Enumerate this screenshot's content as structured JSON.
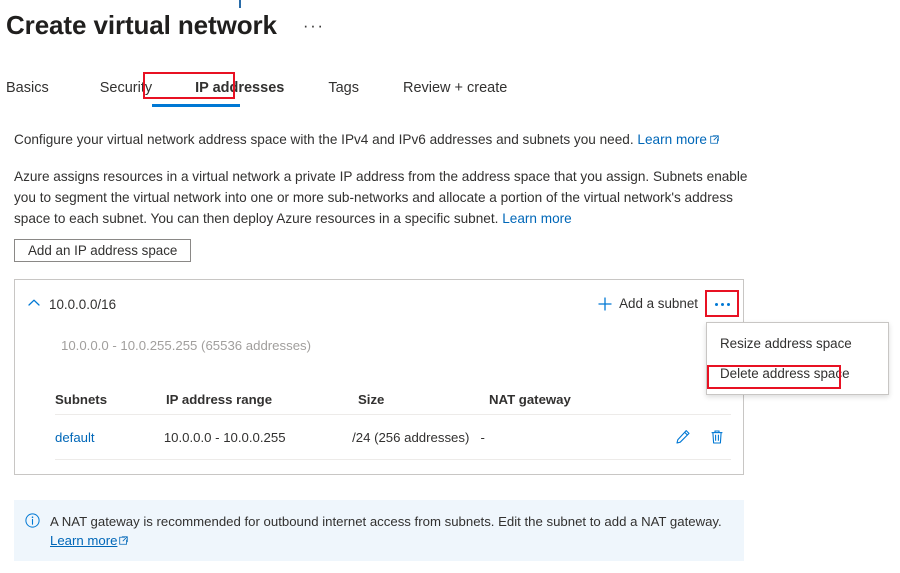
{
  "header": {
    "title": "Create virtual network",
    "ellipsis": "···"
  },
  "tabs": [
    {
      "label": "Basics",
      "selected": false
    },
    {
      "label": "Security",
      "selected": false
    },
    {
      "label": "IP addresses",
      "selected": true
    },
    {
      "label": "Tags",
      "selected": false
    },
    {
      "label": "Review + create",
      "selected": false
    }
  ],
  "intro": {
    "paragraph_1": "Configure your virtual network address space with the IPv4 and IPv6 addresses and subnets you need.",
    "paragraph_1_link": "Learn more",
    "paragraph_2": "Azure assigns resources in a virtual network a private IP address from the address space that you assign. Subnets enable you to segment the virtual network into one or more sub-networks and allocate a portion of the virtual network's address space to each subnet. You can then deploy Azure resources in a specific subnet.",
    "paragraph_2_link": "Learn more"
  },
  "actions": {
    "add_ip_address_space": "Add an IP address space"
  },
  "address_space": {
    "cidr": "10.0.0.0/16",
    "range_summary": "10.0.0.0 - 10.0.255.255 (65536 addresses)",
    "add_subnet_label": "Add a subnet",
    "collapse_icon": "chevron-up-icon",
    "more_icon": "ellipsis-icon"
  },
  "context_menu": {
    "items": [
      {
        "label": "Resize address space",
        "highlighted": false
      },
      {
        "label": "Delete address space",
        "highlighted": true
      }
    ]
  },
  "subnets_table": {
    "columns": [
      "Subnets",
      "IP address range",
      "Size",
      "NAT gateway"
    ],
    "rows": [
      {
        "subnet": "default",
        "ip_address_range": "10.0.0.0 - 10.0.0.255",
        "size": "/24 (256 addresses)",
        "nat_gateway": "-",
        "edit_icon": "pencil-icon",
        "delete_icon": "trash-icon"
      }
    ]
  },
  "banner": {
    "icon": "info-icon",
    "text": "A NAT gateway is recommended for outbound internet access from subnets. Edit the subnet to add a NAT gateway.",
    "link": "Learn more"
  },
  "colors": {
    "accent": "#0078d4",
    "link": "#0067b8",
    "highlight": "#e81123",
    "banner_bg": "#eff6fc",
    "muted": "#a19f9d"
  }
}
